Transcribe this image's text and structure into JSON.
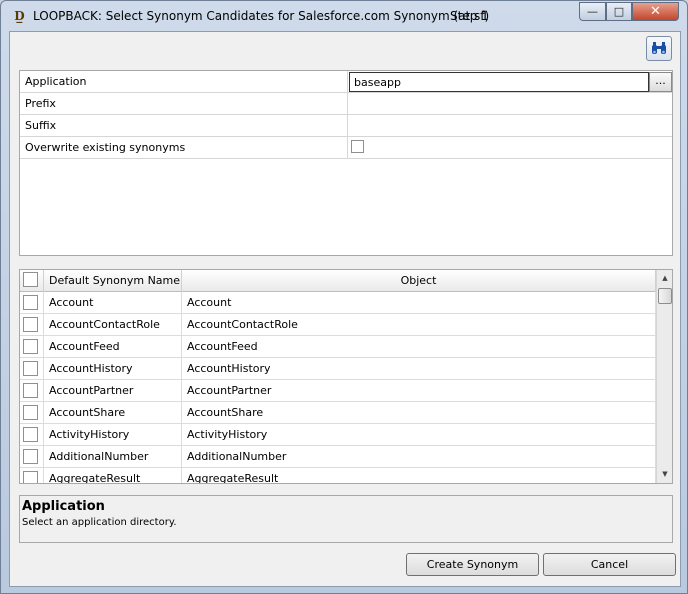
{
  "window": {
    "title": "LOOPBACK: Select Synonym Candidates for Salesforce.com Synonym (at sf)",
    "step": "Step 1",
    "icon": "wizard-icon"
  },
  "toolbar": {
    "find_icon": "binoculars-icon"
  },
  "properties": [
    {
      "label": "Application",
      "value": "baseapp",
      "type": "text-browse"
    },
    {
      "label": "Prefix",
      "value": "",
      "type": "text"
    },
    {
      "label": "Suffix",
      "value": "",
      "type": "text"
    },
    {
      "label": "Overwrite existing synonyms",
      "checked": false,
      "type": "checkbox"
    }
  ],
  "browse_label": "...",
  "grid": {
    "columns": [
      "Default Synonym Name",
      "Object"
    ],
    "rows": [
      {
        "name": "Account",
        "object": "Account",
        "checked": false
      },
      {
        "name": "AccountContactRole",
        "object": "AccountContactRole",
        "checked": false
      },
      {
        "name": "AccountFeed",
        "object": "AccountFeed",
        "checked": false
      },
      {
        "name": "AccountHistory",
        "object": "AccountHistory",
        "checked": false
      },
      {
        "name": "AccountPartner",
        "object": "AccountPartner",
        "checked": false
      },
      {
        "name": "AccountShare",
        "object": "AccountShare",
        "checked": false
      },
      {
        "name": "ActivityHistory",
        "object": "ActivityHistory",
        "checked": false
      },
      {
        "name": "AdditionalNumber",
        "object": "AdditionalNumber",
        "checked": false
      },
      {
        "name": "AggregateResult",
        "object": "AggregateResult",
        "checked": false
      }
    ]
  },
  "help": {
    "title": "Application",
    "text": "Select an application directory."
  },
  "buttons": {
    "create": "Create Synonym",
    "cancel": "Cancel"
  }
}
